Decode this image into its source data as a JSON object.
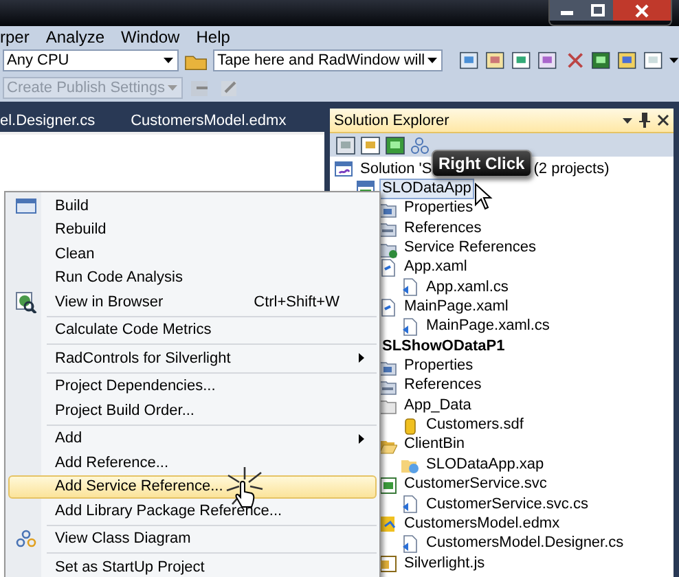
{
  "menu_bar": [
    "rper",
    "Analyze",
    "Window",
    "Help"
  ],
  "toolbar": {
    "platform_combo": "Any CPU",
    "find_combo": "Tape here and RadWindow will",
    "publish_combo": {
      "value": "Create Publish Settings",
      "disabled": true
    }
  },
  "document_tabs": [
    "el.Designer.cs",
    "CustomersModel.edmx"
  ],
  "solution_explorer": {
    "title": "Solution Explorer",
    "tree": [
      {
        "kind": "solution",
        "label": "Solution 'S",
        "suffix": "(2 projects)",
        "selected": false,
        "children": [
          {
            "kind": "project",
            "label": "SLODataApp",
            "selected": true,
            "startup": false,
            "children": [
              {
                "kind": "properties",
                "label": "Properties",
                "selected": false
              },
              {
                "kind": "references",
                "label": "References",
                "selected": false
              },
              {
                "kind": "service-references",
                "label": "Service References",
                "selected": false
              },
              {
                "kind": "xaml",
                "label": "App.xaml",
                "selected": false,
                "children": [
                  {
                    "kind": "cs",
                    "label": "App.xaml.cs",
                    "selected": false
                  }
                ]
              },
              {
                "kind": "xaml",
                "label": "MainPage.xaml",
                "selected": false,
                "children": [
                  {
                    "kind": "cs",
                    "label": "MainPage.xaml.cs",
                    "selected": false
                  }
                ]
              }
            ]
          },
          {
            "kind": "project-covered",
            "label": "SLShowODataP1",
            "selected": false,
            "startup": true,
            "children": [
              {
                "kind": "properties",
                "label": "Properties",
                "selected": false
              },
              {
                "kind": "references",
                "label": "References",
                "selected": false
              },
              {
                "kind": "folder",
                "label": "App_Data",
                "selected": false,
                "children": [
                  {
                    "kind": "database",
                    "label": "Customers.sdf",
                    "selected": false
                  }
                ]
              },
              {
                "kind": "folder-open",
                "label": "ClientBin",
                "selected": false,
                "children": [
                  {
                    "kind": "xap",
                    "label": "SLODataApp.xap",
                    "selected": false
                  }
                ]
              },
              {
                "kind": "svc",
                "label": "CustomerService.svc",
                "selected": false,
                "children": [
                  {
                    "kind": "cs",
                    "label": "CustomerService.svc.cs",
                    "selected": false
                  }
                ]
              },
              {
                "kind": "edmx",
                "label": "CustomersModel.edmx",
                "selected": false,
                "children": [
                  {
                    "kind": "cs",
                    "label": "CustomersModel.Designer.cs",
                    "selected": false
                  }
                ]
              },
              {
                "kind": "js",
                "label": "Silverlight.js",
                "selected": false
              }
            ]
          }
        ]
      }
    ]
  },
  "tooltip": "Right Click",
  "context_menu": [
    {
      "kind": "build",
      "label": "Build",
      "selected": false
    },
    {
      "kind": "plain",
      "label": "Rebuild",
      "selected": false
    },
    {
      "kind": "plain",
      "label": "Clean",
      "selected": false
    },
    {
      "kind": "plain",
      "label": "Run Code Analysis",
      "selected": false
    },
    {
      "kind": "browse",
      "label": "View in Browser",
      "shortcut": "Ctrl+Shift+W",
      "selected": false
    },
    {
      "kind": "separator"
    },
    {
      "kind": "plain",
      "label": "Calculate Code Metrics",
      "selected": false
    },
    {
      "kind": "separator"
    },
    {
      "kind": "plain",
      "label": "RadControls for Silverlight",
      "submenu": true,
      "selected": false
    },
    {
      "kind": "separator"
    },
    {
      "kind": "plain",
      "label": "Project Dependencies...",
      "selected": false
    },
    {
      "kind": "plain",
      "label": "Project Build Order...",
      "selected": false
    },
    {
      "kind": "separator"
    },
    {
      "kind": "plain",
      "label": "Add",
      "submenu": true,
      "selected": false
    },
    {
      "kind": "plain",
      "label": "Add Reference...",
      "selected": false
    },
    {
      "kind": "plain",
      "label": "Add Service Reference...",
      "selected": true
    },
    {
      "kind": "plain",
      "label": "Add Library Package Reference...",
      "selected": false
    },
    {
      "kind": "separator"
    },
    {
      "kind": "diagram",
      "label": "View Class Diagram",
      "selected": false
    },
    {
      "kind": "separator"
    },
    {
      "kind": "plain",
      "label": "Set as StartUp Project",
      "selected": false
    }
  ]
}
